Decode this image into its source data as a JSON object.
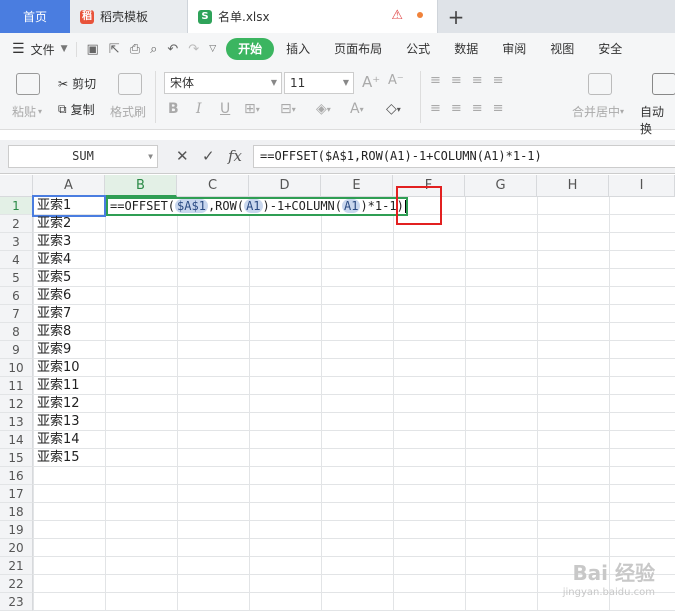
{
  "tabs": {
    "home": "首页",
    "template": "稻壳模板",
    "file": "名单.xlsx"
  },
  "menubar": {
    "file_label": "文件",
    "items": [
      "开始",
      "插入",
      "页面布局",
      "公式",
      "数据",
      "审阅",
      "视图",
      "安全"
    ]
  },
  "ribbon": {
    "paste": "粘贴",
    "cut": "剪切",
    "copy": "复制",
    "format_painter": "格式刷",
    "font_name": "宋体",
    "font_size": "11",
    "merge_center": "合并居中",
    "auto_wrap": "自动换"
  },
  "formula_bar": {
    "name_box": "SUM",
    "formula": "==OFFSET($A$1,ROW(A1)-1+COLUMN(A1)*1-1)"
  },
  "columns": [
    "A",
    "B",
    "C",
    "D",
    "E",
    "F",
    "G",
    "H",
    "I"
  ],
  "rows": [
    "1",
    "2",
    "3",
    "4",
    "5",
    "6",
    "7",
    "8",
    "9",
    "10",
    "11",
    "12",
    "13",
    "14",
    "15",
    "16",
    "17",
    "18",
    "19",
    "20",
    "21",
    "22",
    "23"
  ],
  "column_a": [
    "亚索1",
    "亚索2",
    "亚索3",
    "亚索4",
    "亚索5",
    "亚索6",
    "亚索7",
    "亚索8",
    "亚索9",
    "亚索10",
    "亚索11",
    "亚索12",
    "亚索13",
    "亚索14",
    "亚索15"
  ],
  "edit_cell": {
    "p1": "==OFFSET(",
    "r1": "$A$1",
    "p2": ",ROW(",
    "r2": "A1",
    "p3": ")-1+COLUMN(",
    "r3": "A1",
    "p4": ")*1-1)"
  },
  "watermark": {
    "main": "Bai 经验",
    "sub": "jingyan.baidu.com"
  }
}
